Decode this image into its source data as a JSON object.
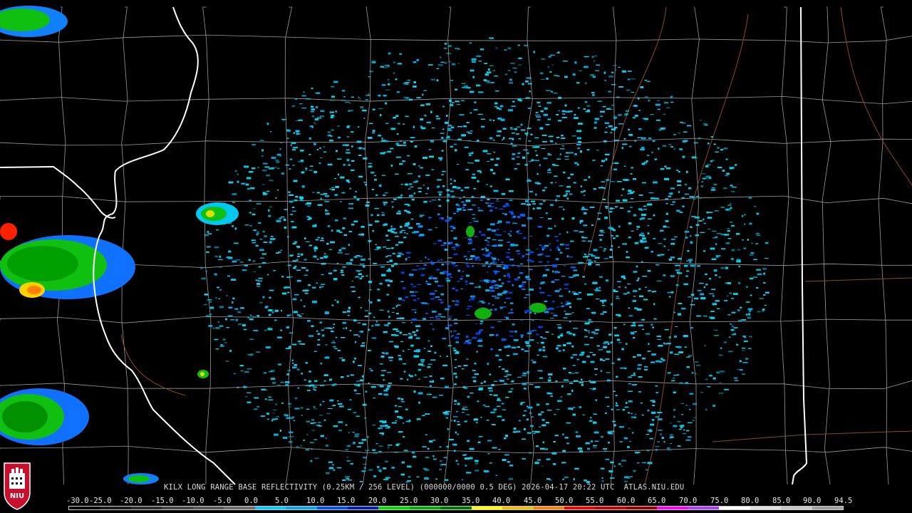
{
  "map": {
    "caption": "KILX LONG RANGE BASE REFLECTIVITY (0.25KM / 256 LEVEL) (000000/0000 0.5 DEG) 2026-04-17 20:22 UTC  ATLAS.NIU.EDU",
    "logo_text": "NIU",
    "colors": {
      "background": "#000000",
      "county_lines": "#9a9a9a",
      "state_lines": "#ffffff",
      "highways": "#8a4a2a",
      "radar_site": "#000000"
    },
    "legend": {
      "ticks": [
        "-30.0",
        "-25.0",
        "-20.0",
        "-15.0",
        "-10.0",
        "-5.0",
        "0.0",
        "5.0",
        "10.0",
        "15.0",
        "20.0",
        "25.0",
        "30.0",
        "35.0",
        "40.0",
        "45.0",
        "50.0",
        "55.0",
        "60.0",
        "65.0",
        "70.0",
        "75.0",
        "80.0",
        "85.0",
        "90.0",
        "94.5"
      ],
      "colors": [
        "#000000",
        "#1a1a1a",
        "#303030",
        "#484848",
        "#5a5a5a",
        "#707070",
        "#00ccff",
        "#00a8f0",
        "#0050ff",
        "#0020c0",
        "#00e000",
        "#00b000",
        "#007a00",
        "#ffff00",
        "#f0c000",
        "#ff8000",
        "#ff0000",
        "#d00000",
        "#a00000",
        "#ff00ff",
        "#b040ff",
        "#ffffff",
        "#e0e0e0",
        "#c8c8c8",
        "#a0a0a0"
      ]
    }
  }
}
